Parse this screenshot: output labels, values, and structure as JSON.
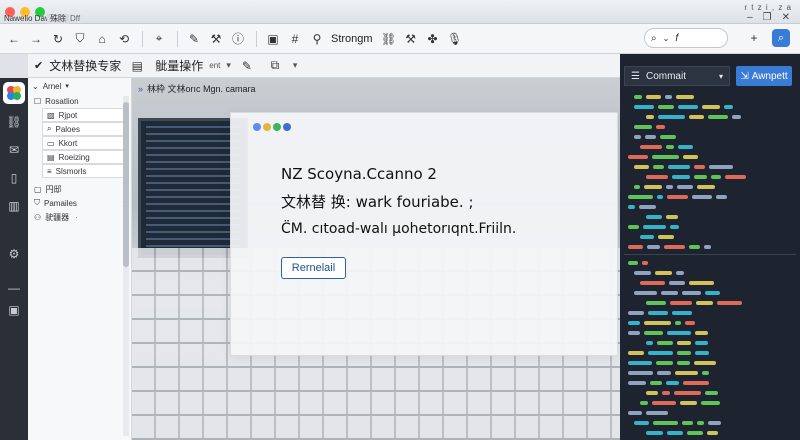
{
  "titlebar": {
    "tabs": [
      "Nawelio Dave",
      "殊除",
      "Dff"
    ],
    "right_text": "r  t z i  ,  z a"
  },
  "toolbar": {
    "text": "Strongm",
    "search_text": "f"
  },
  "subheader": {
    "title": "文林替换专家",
    "menu": "骴量操作",
    "menu_suffix": "ent"
  },
  "sidebar": {
    "head": "Arnel",
    "items": [
      {
        "label": "Rosatlion",
        "boxed": false
      },
      {
        "label": "Rjpot",
        "boxed": true
      },
      {
        "label": "Paloes",
        "boxed": true
      },
      {
        "label": "Kkort",
        "boxed": true
      },
      {
        "label": "Roeizing",
        "boxed": true
      },
      {
        "label": "Slsmorls",
        "boxed": true
      },
      {
        "label": "円邸",
        "boxed": false
      },
      {
        "label": "Pamailes",
        "boxed": false,
        "caret": "›"
      },
      {
        "label": "驶疆器",
        "boxed": false,
        "caret": "·"
      }
    ]
  },
  "main": {
    "breadcrumb": "林枠 文林orıc Mgn. camara"
  },
  "dialog": {
    "line1": "NZ  Scoyna.Ccanno 2",
    "line2": "文林替 换: wark fouriabe.  ;",
    "line3": "C̈M. cıtoad-walı µohetorıqnt.Friiln.",
    "button": "Rernelail"
  },
  "right_panel": {
    "combo": "Commait",
    "button": "Awnpett"
  },
  "colors": {
    "accent": "#3a7bd5",
    "code_teal": "#36b3c9",
    "code_green": "#5fc35a",
    "code_yellow": "#d2c25a",
    "code_red": "#e06a5a"
  }
}
